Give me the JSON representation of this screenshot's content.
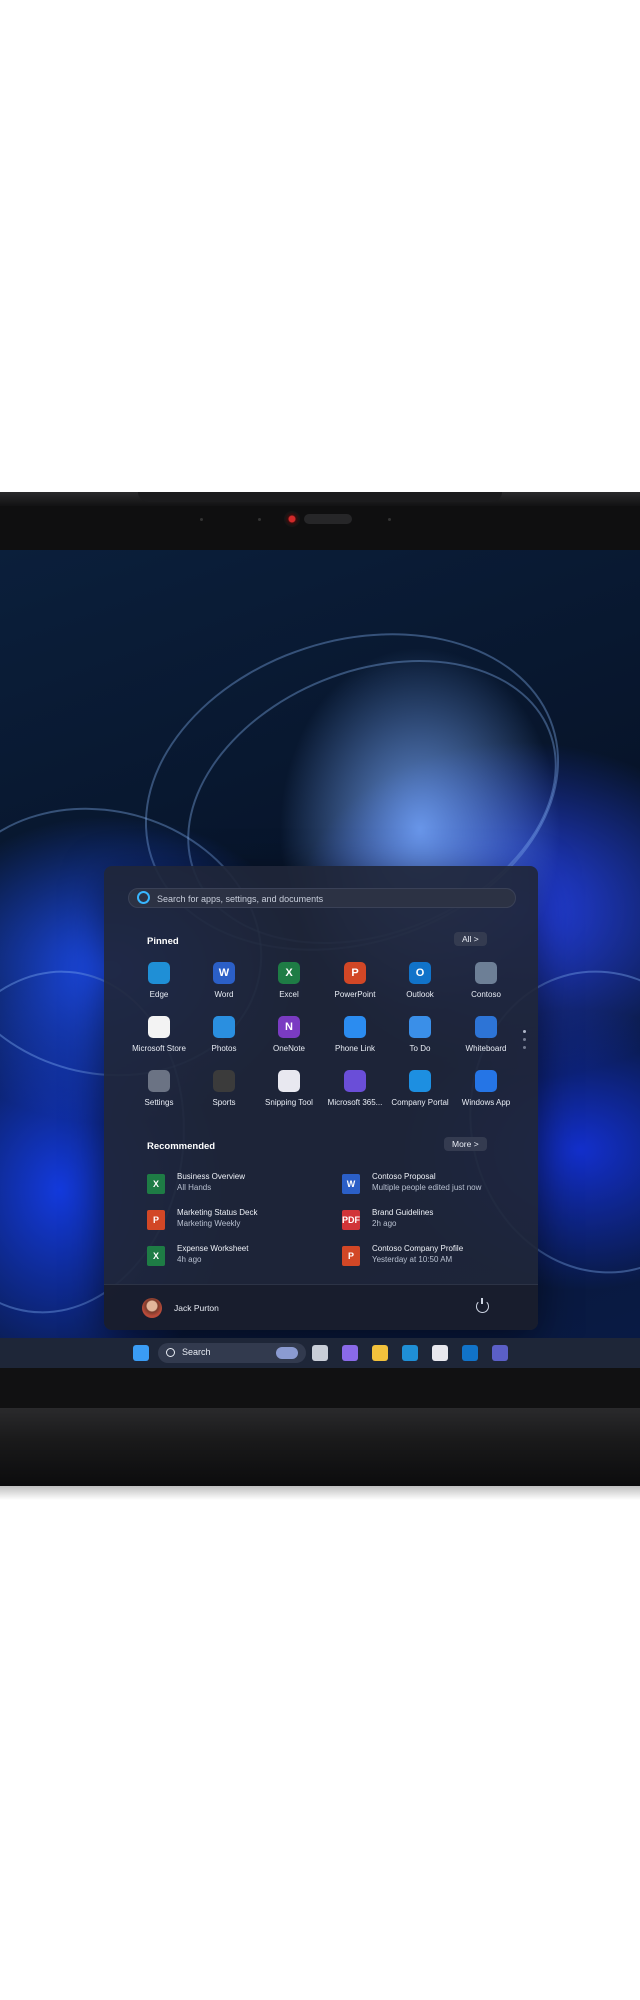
{
  "start_menu": {
    "search_placeholder": "Search for apps, settings, and documents",
    "pinned_title": "Pinned",
    "all_button": "All  >",
    "pinned_apps": [
      {
        "label": "Edge",
        "icon": "edge-icon",
        "color": "#1f8fd6"
      },
      {
        "label": "Word",
        "icon": "word-icon",
        "color": "#2b5fc7"
      },
      {
        "label": "Excel",
        "icon": "excel-icon",
        "color": "#1e7c45"
      },
      {
        "label": "PowerPoint",
        "icon": "powerpoint-icon",
        "color": "#d24726"
      },
      {
        "label": "Outlook",
        "icon": "outlook-icon",
        "color": "#1173c9"
      },
      {
        "label": "Contoso",
        "icon": "contoso-icon",
        "color": "#6d7f96"
      },
      {
        "label": "Microsoft Store",
        "icon": "store-icon",
        "color": "#f3f3f3"
      },
      {
        "label": "Photos",
        "icon": "photos-icon",
        "color": "#2a8fe0"
      },
      {
        "label": "OneNote",
        "icon": "onenote-icon",
        "color": "#7a3bc2"
      },
      {
        "label": "Phone Link",
        "icon": "phone-link-icon",
        "color": "#2b8cf0"
      },
      {
        "label": "To Do",
        "icon": "todo-icon",
        "color": "#3a8fe8"
      },
      {
        "label": "Whiteboard",
        "icon": "whiteboard-icon",
        "color": "#2d74d6"
      },
      {
        "label": "Settings",
        "icon": "settings-icon",
        "color": "#6b7384"
      },
      {
        "label": "Sports",
        "icon": "sports-icon",
        "color": "#3b3b3b"
      },
      {
        "label": "Snipping Tool",
        "icon": "snipping-tool-icon",
        "color": "#e8e8f0"
      },
      {
        "label": "Microsoft 365...",
        "icon": "m365-icon",
        "color": "#6a4ed8"
      },
      {
        "label": "Company Portal",
        "icon": "company-portal-icon",
        "color": "#1d8fe1"
      },
      {
        "label": "Windows App",
        "icon": "windows-app-icon",
        "color": "#2575e6"
      }
    ],
    "recommended_title": "Recommended",
    "more_button": "More  >",
    "recommended": [
      {
        "name": "Business Overview",
        "detail": "All Hands",
        "icon": "excel-file-icon",
        "color": "#1e7c45",
        "glyph": "X"
      },
      {
        "name": "Contoso Proposal",
        "detail": "Multiple people edited just now",
        "icon": "word-file-icon",
        "color": "#2b5fc7",
        "glyph": "W"
      },
      {
        "name": "Marketing Status Deck",
        "detail": "Marketing Weekly",
        "icon": "powerpoint-file-icon",
        "color": "#d24726",
        "glyph": "P"
      },
      {
        "name": "Brand Guidelines",
        "detail": "2h ago",
        "icon": "pdf-file-icon",
        "color": "#d13438",
        "glyph": "PDF"
      },
      {
        "name": "Expense Worksheet",
        "detail": "4h ago",
        "icon": "excel-file-icon",
        "color": "#1e7c45",
        "glyph": "X"
      },
      {
        "name": "Contoso Company Profile",
        "detail": "Yesterday at 10:50 AM",
        "icon": "powerpoint-file-icon",
        "color": "#d24726",
        "glyph": "P"
      }
    ],
    "user_name": "Jack Purton"
  },
  "taskbar": {
    "search_label": "Search",
    "icons": [
      {
        "name": "windows-start-icon",
        "color": "#3a9cf5"
      },
      {
        "name": "task-view-icon",
        "color": "#c9ced8"
      },
      {
        "name": "copilot-icon",
        "color": "#8a6ae8"
      },
      {
        "name": "file-explorer-icon",
        "color": "#f2c13c"
      },
      {
        "name": "edge-icon",
        "color": "#1f8fd6"
      },
      {
        "name": "store-icon",
        "color": "#e8e8ee"
      },
      {
        "name": "outlook-icon",
        "color": "#1173c9"
      },
      {
        "name": "teams-icon",
        "color": "#5b5fc7"
      }
    ]
  }
}
